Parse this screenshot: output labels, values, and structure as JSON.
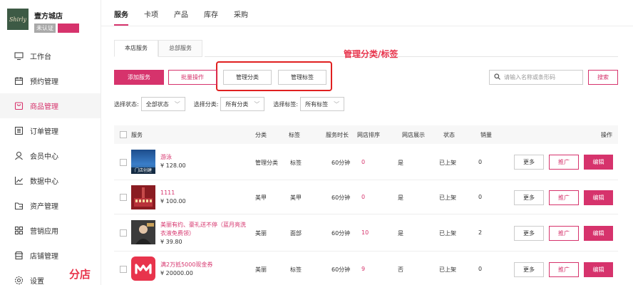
{
  "store": {
    "name": "壹方城店",
    "logo_text": "Shirly",
    "badge_unverified": "未认证",
    "badge_pro": "专业版"
  },
  "sidebar": {
    "items": [
      {
        "label": "工作台",
        "icon": "monitor-icon"
      },
      {
        "label": "预约管理",
        "icon": "calendar-icon"
      },
      {
        "label": "商品管理",
        "icon": "bag-icon"
      },
      {
        "label": "订单管理",
        "icon": "list-icon"
      },
      {
        "label": "会员中心",
        "icon": "user-icon"
      },
      {
        "label": "数据中心",
        "icon": "chart-icon"
      },
      {
        "label": "资产管理",
        "icon": "folder-icon"
      },
      {
        "label": "营销应用",
        "icon": "grid-icon"
      },
      {
        "label": "店铺管理",
        "icon": "store-icon"
      },
      {
        "label": "设置",
        "icon": "gear-icon"
      }
    ]
  },
  "annotation_branch": "分店",
  "annotation_manage": "管理分类/标签",
  "topnav": {
    "tabs": [
      "服务",
      "卡项",
      "产品",
      "库存",
      "采购"
    ]
  },
  "subtabs": [
    "本店服务",
    "总部服务"
  ],
  "toolbar": {
    "add": "添加服务",
    "batch": "批量操作",
    "manage_category": "管理分类",
    "manage_tag": "管理标签",
    "search_placeholder": "请输入名称或条形码",
    "search_btn": "搜索"
  },
  "filters": {
    "status_label": "选择状态:",
    "status_value": "全部状态",
    "category_label": "选择分类:",
    "category_value": "所有分类",
    "tag_label": "选择标签:",
    "tag_value": "所有标签"
  },
  "table": {
    "headers": {
      "service": "服务",
      "category": "分类",
      "tag": "标签",
      "duration": "服务时长",
      "sort": "网店排序",
      "display": "网店展示",
      "status": "状态",
      "sales": "销量",
      "actions": "操作"
    },
    "actions": {
      "more": "更多",
      "promote": "推广",
      "edit": "编辑"
    },
    "rows": [
      {
        "name": "游泳",
        "price": "¥ 128.00",
        "thumb_caption": "门店创建",
        "category": "管理分类",
        "tag": "标签",
        "duration": "60分钟",
        "sort": "0",
        "display": "是",
        "status": "已上架",
        "sales": "0"
      },
      {
        "name": "1111",
        "price": "¥ 100.00",
        "category": "美甲",
        "tag": "美甲",
        "duration": "60分钟",
        "sort": "0",
        "display": "是",
        "status": "已上架",
        "sales": "0"
      },
      {
        "name_line1": "美丽有约、豪礼送不停（蓝月亮洗",
        "name_line2": "衣液免费领）",
        "price": "¥ 39.80",
        "category": "美丽",
        "tag": "面部",
        "duration": "60分钟",
        "sort": "10",
        "display": "是",
        "status": "已上架",
        "sales": "2"
      },
      {
        "name": "满2万抵5000现金券",
        "price": "¥ 20000.00",
        "category": "美丽",
        "tag": "标签",
        "duration": "60分钟",
        "sort": "9",
        "display": "否",
        "status": "已上架",
        "sales": "0"
      }
    ]
  },
  "colors": {
    "accent": "#d6336c",
    "annotation": "#e02020"
  }
}
